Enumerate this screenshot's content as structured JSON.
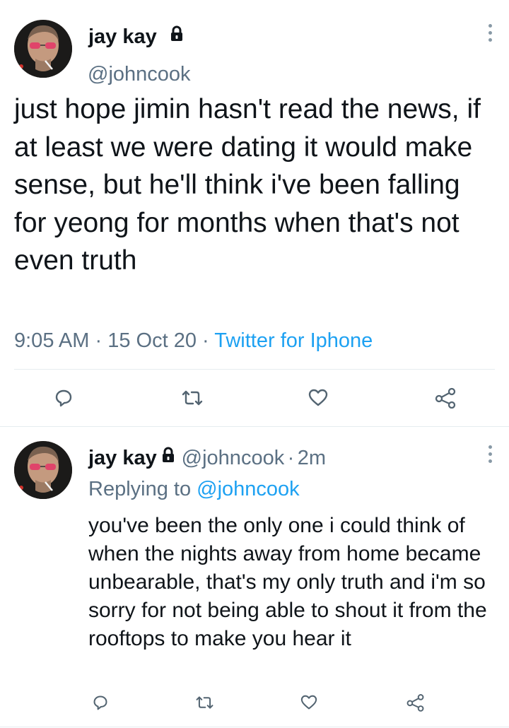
{
  "tweet": {
    "author_name": "jay kay",
    "author_handle": "@johncook",
    "text": "just hope jimin hasn't read the news, if at least we were dating it would make sense, but he'll think i've been falling for yeong for months when that's not even truth",
    "time": "9:05 AM",
    "date": "15 Oct 20",
    "separator": "·",
    "source": "Twitter for Iphone",
    "icons": [
      "reply-icon",
      "retweet-icon",
      "like-icon",
      "share-icon",
      "lock-icon",
      "more-icon"
    ]
  },
  "reply": {
    "author_name": "jay kay",
    "author_handle": "@johncook",
    "separator": "·",
    "age": "2m",
    "replying_prefix": "Replying to",
    "replying_to": "@johncook",
    "text": "you've been the only one i could think of when the nights away from home became unbearable, that's my only truth and i'm so sorry for not being able to shout it from the rooftops to make you hear it"
  },
  "colors": {
    "text": "#0f1419",
    "secondary": "#5b7083",
    "accent": "#1da1f2",
    "divider": "#e6ecf0"
  }
}
